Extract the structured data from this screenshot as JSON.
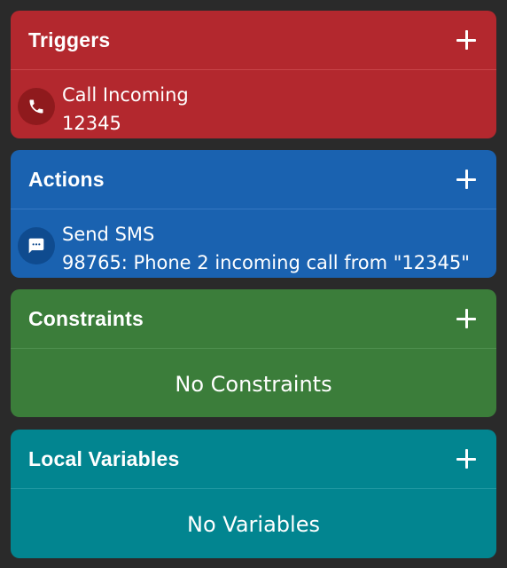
{
  "triggers": {
    "title": "Triggers",
    "items": [
      {
        "icon": "phone-icon",
        "line1": "Call Incoming",
        "line2": "12345"
      }
    ]
  },
  "actions": {
    "title": "Actions",
    "items": [
      {
        "icon": "message-icon",
        "line1": "Send SMS",
        "line2": "98765: Phone 2 incoming call from \"12345\""
      }
    ]
  },
  "constraints": {
    "title": "Constraints",
    "empty_text": "No Constraints"
  },
  "local_variables": {
    "title": "Local Variables",
    "empty_text": "No Variables"
  },
  "colors": {
    "triggers": "#b3282e",
    "actions": "#1a62b0",
    "constraints": "#3b7d3a",
    "local_variables": "#028590",
    "background": "#2a2a2a"
  }
}
